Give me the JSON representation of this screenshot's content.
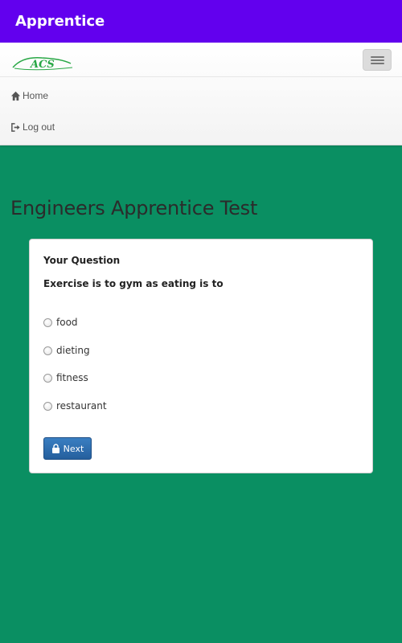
{
  "appbar": {
    "title": "Apprentice",
    "color": "#6200ee"
  },
  "navbar": {
    "brand": "ACS",
    "menu_icon": "hamburger-icon",
    "items": [
      {
        "label": "Home",
        "icon": "home-icon"
      },
      {
        "label": "Log out",
        "icon": "logout-icon"
      }
    ]
  },
  "page": {
    "title": "Engineers Apprentice Test",
    "background": "#0a8f62"
  },
  "question": {
    "heading": "Your Question",
    "text": "Exercise is to gym as eating is to",
    "options": [
      "food",
      "dieting",
      "fitness",
      "restaurant"
    ],
    "selected": null
  },
  "actions": {
    "next_label": "Next",
    "next_icon": "lock-icon",
    "button_color": "#2d6fae"
  }
}
